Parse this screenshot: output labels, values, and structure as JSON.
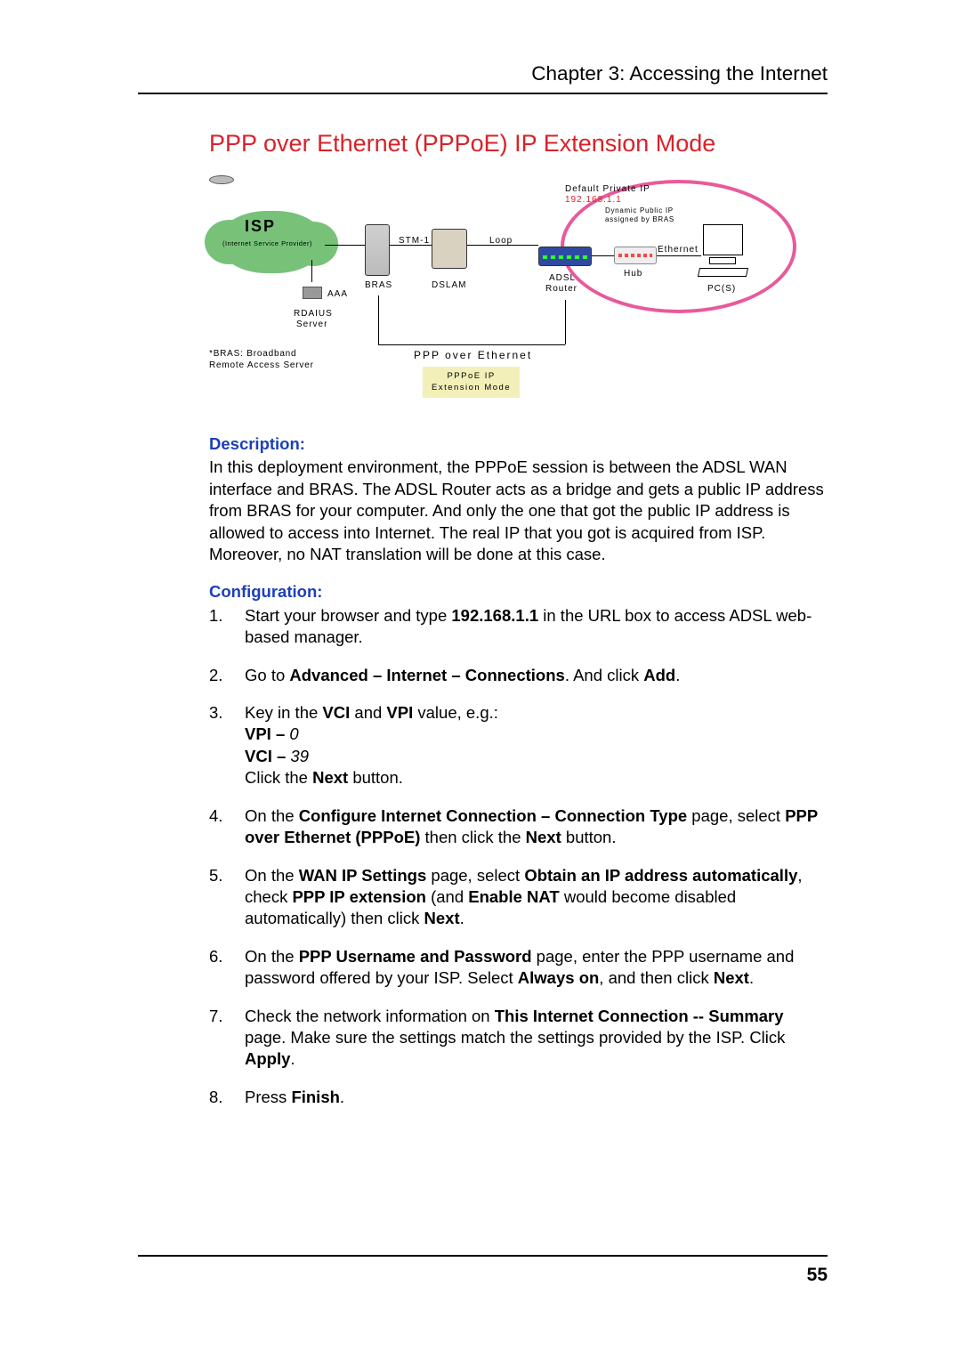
{
  "header": {
    "chapter": "Chapter 3: Accessing the Internet"
  },
  "title": "PPP over Ethernet (PPPoE) IP Extension Mode",
  "diagram": {
    "isp": "ISP",
    "isp_sub": "(Internet Service Provider)",
    "stm": "STM-1",
    "loop": "Loop",
    "default_ip_label": "Default Private IP",
    "default_ip_value": "192.168.1.1",
    "dyn_ip_l1": "Dynamic Public IP",
    "dyn_ip_l2": "assigned by BRAS",
    "ethernet": "Ethernet",
    "bras": "BRAS",
    "dslam": "DSLAM",
    "adsl_router_l1": "ADSL",
    "adsl_router_l2": "Router",
    "hub": "Hub",
    "pcs": "PC(S)",
    "aaa": "AAA",
    "radius_l1": "RDAIUS",
    "radius_l2": "Server",
    "note_l1": "*BRAS: Broadband",
    "note_l2": "Remote Access Server",
    "ppp_over_ethernet": "PPP over Ethernet",
    "pppoe_box_l1": "PPPoE IP",
    "pppoe_box_l2": "Extension Mode"
  },
  "description": {
    "heading": "Description:",
    "text": "In this deployment environment, the PPPoE session is between the ADSL WAN interface and BRAS. The ADSL Router acts as a bridge and gets a public IP address from BRAS for your computer. And only the one that got the public IP address is allowed to access into Internet. The real IP that you got is acquired from ISP. Moreover, no NAT translation will be done at this case."
  },
  "configuration": {
    "heading": "Configuration:",
    "steps": {
      "s1a": "Start your browser and type ",
      "s1b": "192.168.1.1",
      "s1c": " in the URL box to access ADSL web-based manager.",
      "s2a": "Go to ",
      "s2b": "Advanced – Internet – Connections",
      "s2c": ". And click ",
      "s2d": "Add",
      "s2e": ".",
      "s3a": "Key in the ",
      "s3b": "VCI",
      "s3c": " and ",
      "s3d": "VPI",
      "s3e": " value, e.g.:",
      "s3f": "VPI – ",
      "s3g": "0",
      "s3h": "VCI – ",
      "s3i": "39",
      "s3j": "Click the ",
      "s3k": "Next",
      "s3l": " button.",
      "s4a": "On the ",
      "s4b": "Configure Internet Connection – Connection Type",
      "s4c": " page, select ",
      "s4d": "PPP over Ethernet (PPPoE)",
      "s4e": " then click the ",
      "s4f": "Next",
      "s4g": " button.",
      "s5a": "On the ",
      "s5b": "WAN IP Settings",
      "s5c": " page, select ",
      "s5d": "Obtain an IP address automatically",
      "s5e": ", check ",
      "s5f": "PPP IP extension",
      "s5g": " (and ",
      "s5h": "Enable NAT",
      "s5i": " would become disabled automatically) then click ",
      "s5j": "Next",
      "s5k": ".",
      "s6a": "On the ",
      "s6b": "PPP Username and Password",
      "s6c": " page, enter the PPP username and password offered by your ISP. Select ",
      "s6d": "Always on",
      "s6e": ", and then click ",
      "s6f": "Next",
      "s6g": ".",
      "s7a": "Check the network information on ",
      "s7b": "This Internet Connection -- Summary",
      "s7c": " page. Make sure the settings match the settings provided by the ISP. Click ",
      "s7d": "Apply",
      "s7e": ".",
      "s8a": "Press ",
      "s8b": "Finish",
      "s8c": "."
    }
  },
  "page_number": "55"
}
